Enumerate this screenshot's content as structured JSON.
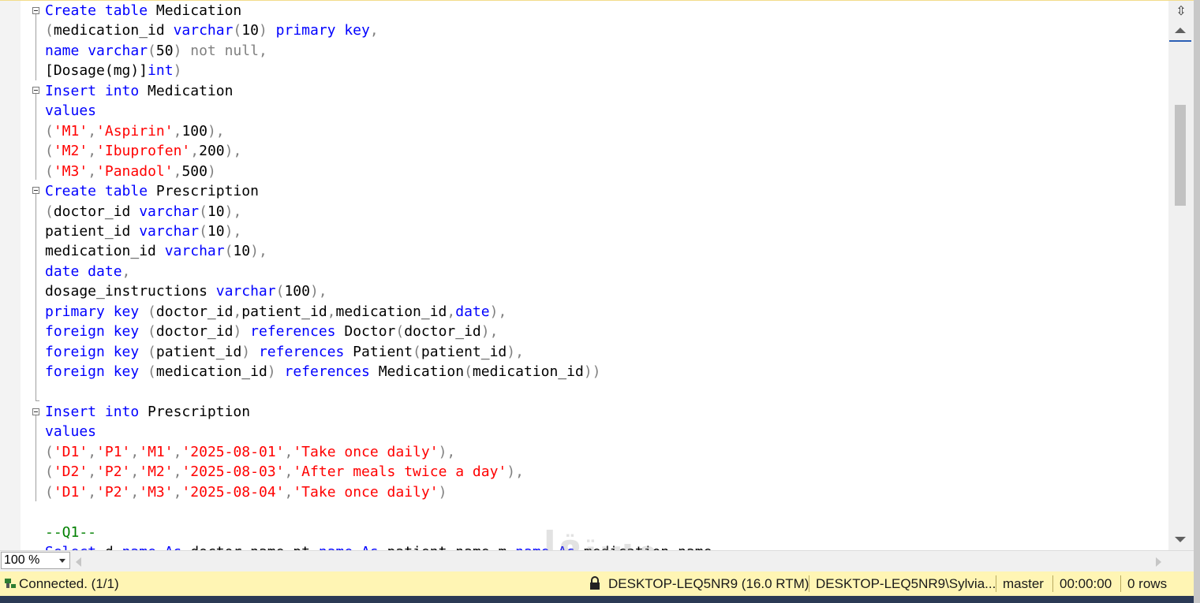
{
  "editor": {
    "lines": [
      {
        "segments": [
          {
            "t": "Create table",
            "c": "kw"
          },
          {
            "t": " Medication",
            "c": "tx"
          }
        ]
      },
      {
        "segments": [
          {
            "t": "(",
            "c": "gr"
          },
          {
            "t": "medication_id ",
            "c": "tx"
          },
          {
            "t": "varchar",
            "c": "kw"
          },
          {
            "t": "(",
            "c": "gr"
          },
          {
            "t": "10",
            "c": "tx"
          },
          {
            "t": ") ",
            "c": "gr"
          },
          {
            "t": "primary key",
            "c": "kw"
          },
          {
            "t": ",",
            "c": "gr"
          }
        ]
      },
      {
        "segments": [
          {
            "t": "name ",
            "c": "kw"
          },
          {
            "t": "varchar",
            "c": "kw"
          },
          {
            "t": "(",
            "c": "gr"
          },
          {
            "t": "50",
            "c": "tx"
          },
          {
            "t": ") not null,",
            "c": "gr"
          }
        ]
      },
      {
        "segments": [
          {
            "t": "[Dosage(mg)]",
            "c": "tx"
          },
          {
            "t": "int",
            "c": "kw"
          },
          {
            "t": ")",
            "c": "gr"
          }
        ]
      },
      {
        "segments": [
          {
            "t": "Insert into",
            "c": "kw"
          },
          {
            "t": " Medication",
            "c": "tx"
          }
        ]
      },
      {
        "segments": [
          {
            "t": "values",
            "c": "kw"
          }
        ]
      },
      {
        "segments": [
          {
            "t": "(",
            "c": "gr"
          },
          {
            "t": "'M1'",
            "c": "str"
          },
          {
            "t": ",",
            "c": "gr"
          },
          {
            "t": "'Aspirin'",
            "c": "str"
          },
          {
            "t": ",",
            "c": "gr"
          },
          {
            "t": "100",
            "c": "tx"
          },
          {
            "t": "),",
            "c": "gr"
          }
        ]
      },
      {
        "segments": [
          {
            "t": "(",
            "c": "gr"
          },
          {
            "t": "'M2'",
            "c": "str"
          },
          {
            "t": ",",
            "c": "gr"
          },
          {
            "t": "'Ibuprofen'",
            "c": "str"
          },
          {
            "t": ",",
            "c": "gr"
          },
          {
            "t": "200",
            "c": "tx"
          },
          {
            "t": "),",
            "c": "gr"
          }
        ]
      },
      {
        "segments": [
          {
            "t": "(",
            "c": "gr"
          },
          {
            "t": "'M3'",
            "c": "str"
          },
          {
            "t": ",",
            "c": "gr"
          },
          {
            "t": "'Panadol'",
            "c": "str"
          },
          {
            "t": ",",
            "c": "gr"
          },
          {
            "t": "500",
            "c": "tx"
          },
          {
            "t": ")",
            "c": "gr"
          }
        ]
      },
      {
        "segments": [
          {
            "t": "Create table",
            "c": "kw"
          },
          {
            "t": " Prescription",
            "c": "tx"
          }
        ]
      },
      {
        "segments": [
          {
            "t": "(",
            "c": "gr"
          },
          {
            "t": "doctor_id ",
            "c": "tx"
          },
          {
            "t": "varchar",
            "c": "kw"
          },
          {
            "t": "(",
            "c": "gr"
          },
          {
            "t": "10",
            "c": "tx"
          },
          {
            "t": "),",
            "c": "gr"
          }
        ]
      },
      {
        "segments": [
          {
            "t": "patient_id ",
            "c": "tx"
          },
          {
            "t": "varchar",
            "c": "kw"
          },
          {
            "t": "(",
            "c": "gr"
          },
          {
            "t": "10",
            "c": "tx"
          },
          {
            "t": "),",
            "c": "gr"
          }
        ]
      },
      {
        "segments": [
          {
            "t": "medication_id ",
            "c": "tx"
          },
          {
            "t": "varchar",
            "c": "kw"
          },
          {
            "t": "(",
            "c": "gr"
          },
          {
            "t": "10",
            "c": "tx"
          },
          {
            "t": "),",
            "c": "gr"
          }
        ]
      },
      {
        "segments": [
          {
            "t": "date date",
            "c": "kw"
          },
          {
            "t": ",",
            "c": "gr"
          }
        ]
      },
      {
        "segments": [
          {
            "t": "dosage_instructions ",
            "c": "tx"
          },
          {
            "t": "varchar",
            "c": "kw"
          },
          {
            "t": "(",
            "c": "gr"
          },
          {
            "t": "100",
            "c": "tx"
          },
          {
            "t": "),",
            "c": "gr"
          }
        ]
      },
      {
        "segments": [
          {
            "t": "primary key",
            "c": "kw"
          },
          {
            "t": " (",
            "c": "gr"
          },
          {
            "t": "doctor_id",
            "c": "tx"
          },
          {
            "t": ",",
            "c": "gr"
          },
          {
            "t": "patient_id",
            "c": "tx"
          },
          {
            "t": ",",
            "c": "gr"
          },
          {
            "t": "medication_id",
            "c": "tx"
          },
          {
            "t": ",",
            "c": "gr"
          },
          {
            "t": "date",
            "c": "kw"
          },
          {
            "t": "),",
            "c": "gr"
          }
        ]
      },
      {
        "segments": [
          {
            "t": "foreign key",
            "c": "kw"
          },
          {
            "t": " (",
            "c": "gr"
          },
          {
            "t": "doctor_id",
            "c": "tx"
          },
          {
            "t": ") ",
            "c": "gr"
          },
          {
            "t": "references",
            "c": "kw"
          },
          {
            "t": " Doctor",
            "c": "tx"
          },
          {
            "t": "(",
            "c": "gr"
          },
          {
            "t": "doctor_id",
            "c": "tx"
          },
          {
            "t": "),",
            "c": "gr"
          }
        ]
      },
      {
        "segments": [
          {
            "t": "foreign key",
            "c": "kw"
          },
          {
            "t": " (",
            "c": "gr"
          },
          {
            "t": "patient_id",
            "c": "tx"
          },
          {
            "t": ") ",
            "c": "gr"
          },
          {
            "t": "references",
            "c": "kw"
          },
          {
            "t": " Patient",
            "c": "tx"
          },
          {
            "t": "(",
            "c": "gr"
          },
          {
            "t": "patient_id",
            "c": "tx"
          },
          {
            "t": "),",
            "c": "gr"
          }
        ]
      },
      {
        "segments": [
          {
            "t": "foreign key",
            "c": "kw"
          },
          {
            "t": " (",
            "c": "gr"
          },
          {
            "t": "medication_id",
            "c": "tx"
          },
          {
            "t": ") ",
            "c": "gr"
          },
          {
            "t": "references",
            "c": "kw"
          },
          {
            "t": " Medication",
            "c": "tx"
          },
          {
            "t": "(",
            "c": "gr"
          },
          {
            "t": "medication_id",
            "c": "tx"
          },
          {
            "t": "))",
            "c": "gr"
          }
        ]
      },
      {
        "segments": []
      },
      {
        "segments": [
          {
            "t": "Insert into",
            "c": "kw"
          },
          {
            "t": " Prescription",
            "c": "tx"
          }
        ]
      },
      {
        "segments": [
          {
            "t": "values",
            "c": "kw"
          }
        ]
      },
      {
        "segments": [
          {
            "t": "(",
            "c": "gr"
          },
          {
            "t": "'D1'",
            "c": "str"
          },
          {
            "t": ",",
            "c": "gr"
          },
          {
            "t": "'P1'",
            "c": "str"
          },
          {
            "t": ",",
            "c": "gr"
          },
          {
            "t": "'M1'",
            "c": "str"
          },
          {
            "t": ",",
            "c": "gr"
          },
          {
            "t": "'2025-08-01'",
            "c": "str"
          },
          {
            "t": ",",
            "c": "gr"
          },
          {
            "t": "'Take once daily'",
            "c": "str"
          },
          {
            "t": "),",
            "c": "gr"
          }
        ]
      },
      {
        "segments": [
          {
            "t": "(",
            "c": "gr"
          },
          {
            "t": "'D2'",
            "c": "str"
          },
          {
            "t": ",",
            "c": "gr"
          },
          {
            "t": "'P2'",
            "c": "str"
          },
          {
            "t": ",",
            "c": "gr"
          },
          {
            "t": "'M2'",
            "c": "str"
          },
          {
            "t": ",",
            "c": "gr"
          },
          {
            "t": "'2025-08-03'",
            "c": "str"
          },
          {
            "t": ",",
            "c": "gr"
          },
          {
            "t": "'After meals twice a day'",
            "c": "str"
          },
          {
            "t": "),",
            "c": "gr"
          }
        ]
      },
      {
        "segments": [
          {
            "t": "(",
            "c": "gr"
          },
          {
            "t": "'D1'",
            "c": "str"
          },
          {
            "t": ",",
            "c": "gr"
          },
          {
            "t": "'P2'",
            "c": "str"
          },
          {
            "t": ",",
            "c": "gr"
          },
          {
            "t": "'M3'",
            "c": "str"
          },
          {
            "t": ",",
            "c": "gr"
          },
          {
            "t": "'2025-08-04'",
            "c": "str"
          },
          {
            "t": ",",
            "c": "gr"
          },
          {
            "t": "'Take once daily'",
            "c": "str"
          },
          {
            "t": ")",
            "c": "gr"
          }
        ]
      },
      {
        "segments": []
      },
      {
        "segments": [
          {
            "t": "--Q1--",
            "c": "cm"
          }
        ]
      },
      {
        "segments": [
          {
            "t": "Select",
            "c": "kw"
          },
          {
            "t": " d",
            "c": "tx"
          },
          {
            "t": ".",
            "c": "gr"
          },
          {
            "t": "name ",
            "c": "kw"
          },
          {
            "t": "As",
            "c": "kw"
          },
          {
            "t": " doctor_name",
            "c": "tx"
          },
          {
            "t": ",",
            "c": "gr"
          },
          {
            "t": "pt",
            "c": "tx"
          },
          {
            "t": ".",
            "c": "gr"
          },
          {
            "t": "name ",
            "c": "kw"
          },
          {
            "t": "As",
            "c": "kw"
          },
          {
            "t": " patient_name",
            "c": "tx"
          },
          {
            "t": ",",
            "c": "gr"
          },
          {
            "t": "m",
            "c": "tx"
          },
          {
            "t": ".",
            "c": "gr"
          },
          {
            "t": "name ",
            "c": "kw"
          },
          {
            "t": "As",
            "c": "kw"
          },
          {
            "t": " medication_name",
            "c": "tx"
          }
        ]
      }
    ]
  },
  "zoom": {
    "value": "100 %"
  },
  "status": {
    "connection": "Connected. (1/1)",
    "server": "DESKTOP-LEQ5NR9 (16.0 RTM)",
    "user": "DESKTOP-LEQ5NR9\\Sylvia...",
    "database": "master",
    "elapsed": "00:00:00",
    "rows": "0 rows"
  },
  "watermark": {
    "main": "مستقل",
    "sub": "mostaql.com"
  },
  "icons": {
    "split": "split-window-icon",
    "connection": "connected-plug-icon",
    "server": "lock-server-icon"
  },
  "colors": {
    "keyword": "#0000ff",
    "string": "#ff0000",
    "operator": "#808080",
    "comment": "#008000",
    "status_bar": "#fff5b4"
  }
}
